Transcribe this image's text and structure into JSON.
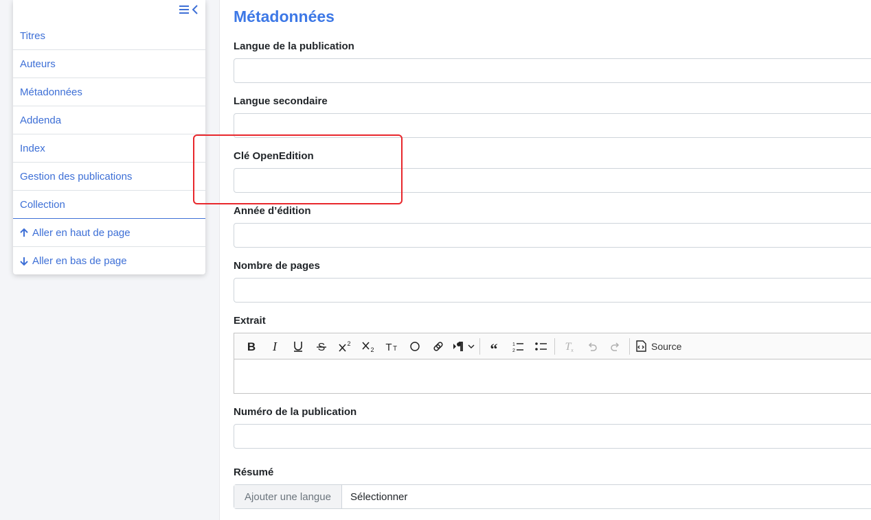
{
  "nav": {
    "items": [
      {
        "label": "Titres",
        "name": "nav-item-titres"
      },
      {
        "label": "Auteurs",
        "name": "nav-item-auteurs"
      },
      {
        "label": "Métadonnées",
        "name": "nav-item-metadonnees"
      },
      {
        "label": "Addenda",
        "name": "nav-item-addenda"
      },
      {
        "label": "Index",
        "name": "nav-item-index"
      },
      {
        "label": "Gestion des publications",
        "name": "nav-item-gestion-publications"
      },
      {
        "label": "Collection",
        "name": "nav-item-collection"
      }
    ],
    "go_top": "Aller en haut de page",
    "go_bottom": "Aller en bas de page"
  },
  "main": {
    "title": "Métadonnées",
    "fields": {
      "langue_publication": {
        "label": "Langue de la publication",
        "value": ""
      },
      "langue_secondaire": {
        "label": "Langue secondaire",
        "value": ""
      },
      "cle_openedition": {
        "label": "Clé OpenEdition",
        "value": ""
      },
      "annee_edition": {
        "label": "Année d’édition",
        "value": ""
      },
      "nombre_pages": {
        "label": "Nombre de pages",
        "value": ""
      },
      "extrait": {
        "label": "Extrait"
      },
      "numero_publication": {
        "label": "Numéro de la publication",
        "value": ""
      },
      "resume": {
        "label": "Résumé",
        "add_language": "Ajouter une langue",
        "select": "Sélectionner"
      }
    },
    "editor": {
      "source_label": "Source",
      "toolbar_icons": [
        "bold-icon",
        "italic-icon",
        "underline-icon",
        "strikethrough-icon",
        "superscript-icon",
        "subscript-icon",
        "small-caps-icon",
        "circle-icon",
        "link-icon",
        "paragraph-direction-icon",
        "blockquote-icon",
        "numbered-list-icon",
        "bulleted-list-icon",
        "remove-format-icon",
        "undo-icon",
        "redo-icon",
        "source-icon"
      ]
    }
  },
  "colors": {
    "accent": "#3d6fd6",
    "title": "#3d78e6",
    "highlight": "#e8262b"
  }
}
